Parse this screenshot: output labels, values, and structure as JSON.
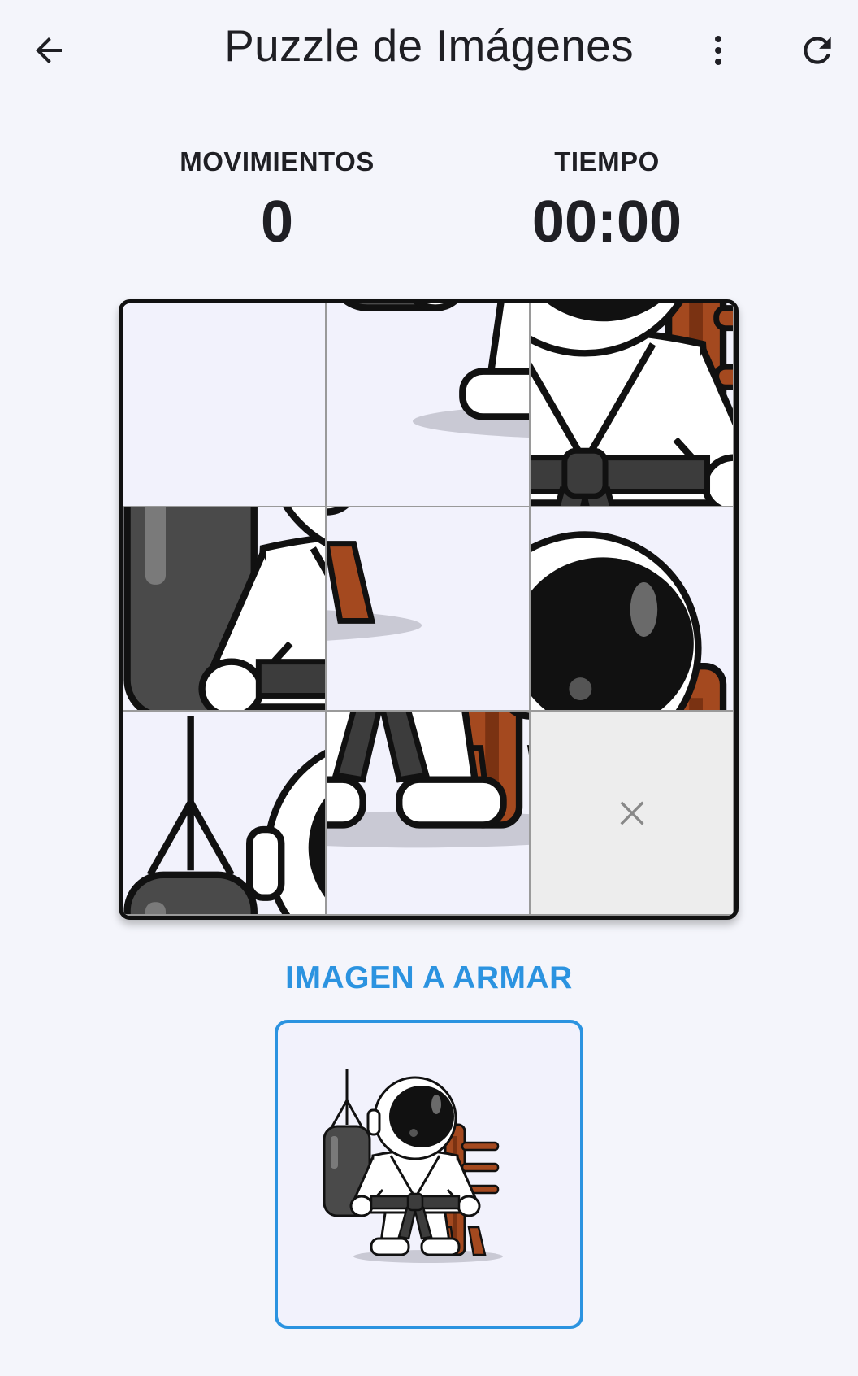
{
  "header": {
    "title": "Puzzle de Imágenes",
    "back_icon": "arrow-back-icon",
    "menu_icon": "more-vert-icon",
    "refresh_icon": "refresh-icon"
  },
  "stats": {
    "moves_label": "MOVIMIENTOS",
    "moves_value": "0",
    "time_label": "TIEMPO",
    "time_value": "00:00"
  },
  "board": {
    "grid_size": 3,
    "tiles": [
      {
        "row": 0,
        "col": 0,
        "piece": 2
      },
      {
        "row": 0,
        "col": 1,
        "piece": 6
      },
      {
        "row": 0,
        "col": 2,
        "piece": 4
      },
      {
        "row": 1,
        "col": 0,
        "piece": 3
      },
      {
        "row": 1,
        "col": 1,
        "piece": 8
      },
      {
        "row": 1,
        "col": 2,
        "piece": 1
      },
      {
        "row": 2,
        "col": 0,
        "piece": 0
      },
      {
        "row": 2,
        "col": 1,
        "piece": 7
      },
      {
        "row": 2,
        "col": 2,
        "piece": null
      }
    ],
    "empty_icon": "close-icon"
  },
  "reference": {
    "label": "IMAGEN A ARMAR",
    "image_name": "karate-astronaut-image"
  },
  "colors": {
    "accent": "#2b93e0",
    "background": "#f4f5fb",
    "empty_tile": "#ededed"
  }
}
